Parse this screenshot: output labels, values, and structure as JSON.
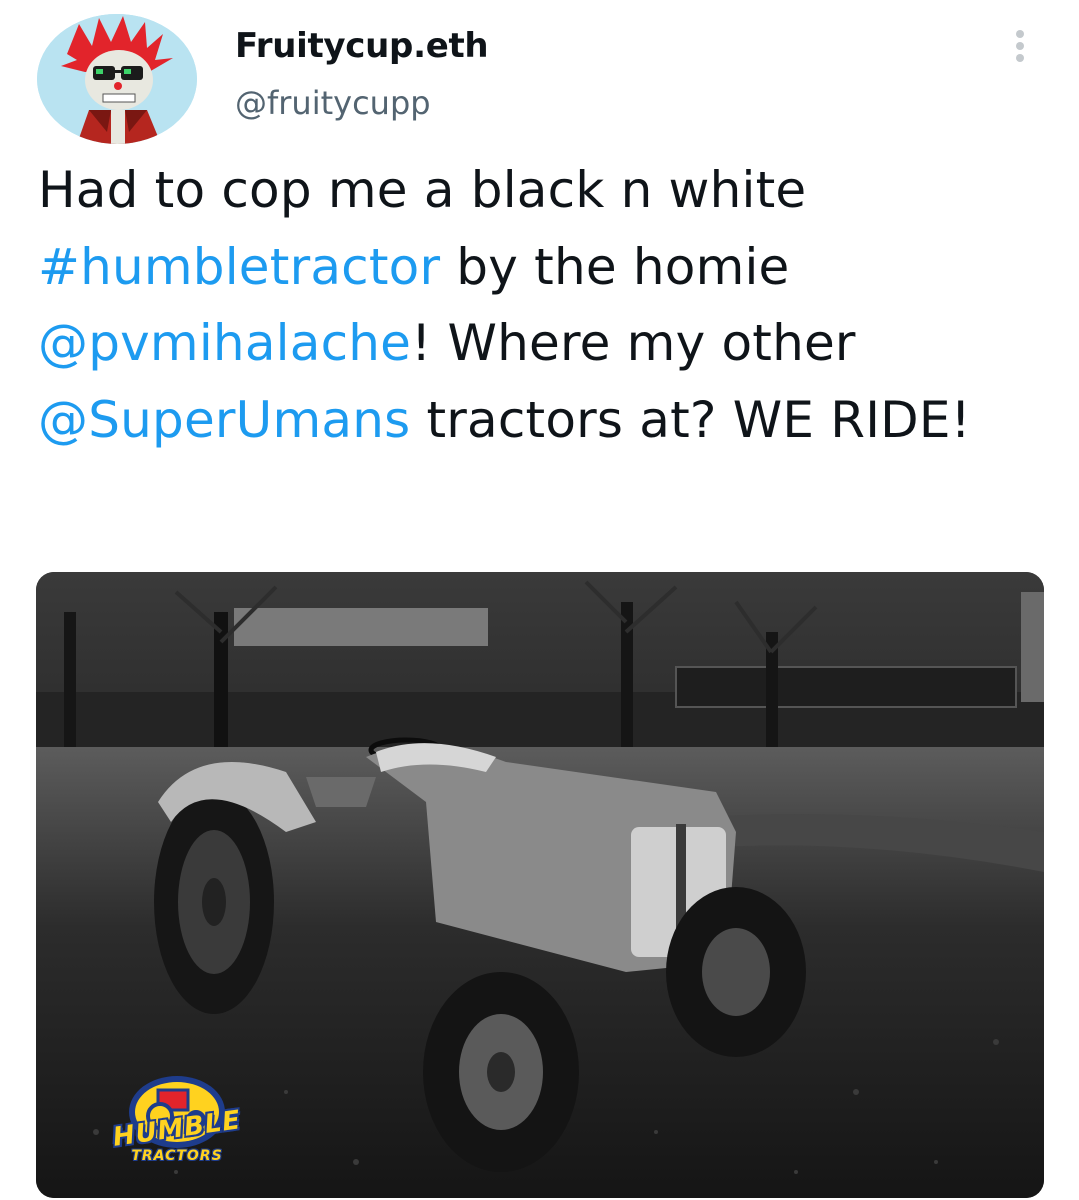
{
  "author": {
    "display_name": "Fruitycup.eth",
    "handle": "@fruitycupp",
    "avatar_icon": "cartoon-character-avatar"
  },
  "more_icon": "more-vertical-icon",
  "tweet": {
    "segments": [
      {
        "text": "Had to cop me a black n white ",
        "type": "text"
      },
      {
        "text": "#humbletractor",
        "type": "hashtag"
      },
      {
        "text": " by the homie ",
        "type": "text"
      },
      {
        "text": "@pvmihalache",
        "type": "mention"
      },
      {
        "text": "! Where my other ",
        "type": "text"
      },
      {
        "text": "@SuperUmans",
        "type": "mention"
      },
      {
        "text": " tractors at? WE RIDE!",
        "type": "text"
      }
    ]
  },
  "media": {
    "description_icon": "tractor-photo",
    "logo": {
      "line1": "HUMBLE",
      "line2": "TRACTORS"
    }
  },
  "colors": {
    "link": "#1d9bf0",
    "text": "#0f1419",
    "secondary": "#536471",
    "avatar_bg": "#b9e3f1"
  }
}
